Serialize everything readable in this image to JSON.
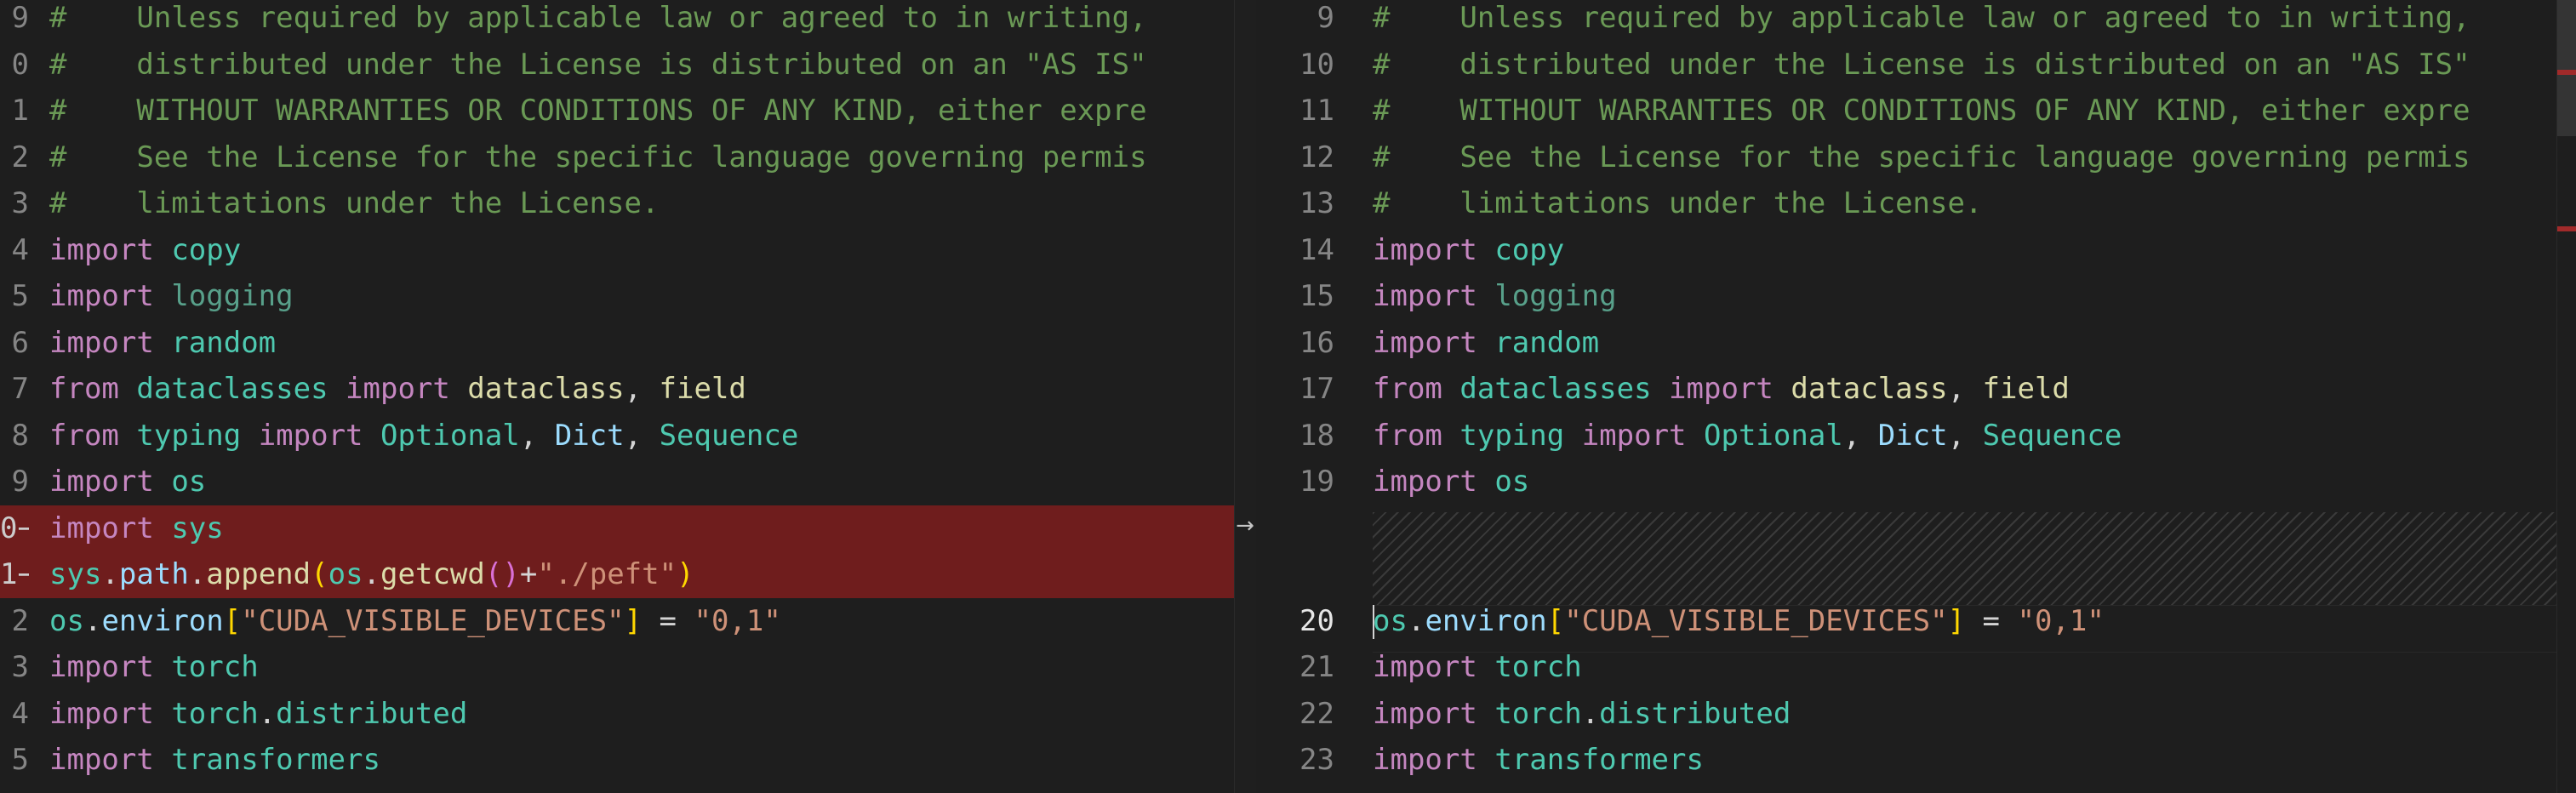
{
  "editor": {
    "mode": "diff",
    "revert_icon": "→",
    "colors": {
      "removed_bg": "#6f1d1d",
      "background": "#1e1e1e"
    }
  },
  "left": {
    "lines": [
      {
        "num": "9",
        "marker": "",
        "text": "#    Unless required by applicable law or agreed to in writing,"
      },
      {
        "num": "0",
        "marker": "",
        "text": "#    distributed under the License is distributed on an \"AS IS\""
      },
      {
        "num": "1",
        "marker": "",
        "text": "#    WITHOUT WARRANTIES OR CONDITIONS OF ANY KIND, either expre"
      },
      {
        "num": "2",
        "marker": "",
        "text": "#    See the License for the specific language governing permis"
      },
      {
        "num": "3",
        "marker": "",
        "text": "#    limitations under the License."
      },
      {
        "num": "4",
        "marker": "",
        "text": "import copy"
      },
      {
        "num": "5",
        "marker": "",
        "text": "import logging"
      },
      {
        "num": "6",
        "marker": "",
        "text": "import random"
      },
      {
        "num": "7",
        "marker": "",
        "text": "from dataclasses import dataclass, field"
      },
      {
        "num": "8",
        "marker": "",
        "text": "from typing import Optional, Dict, Sequence"
      },
      {
        "num": "9",
        "marker": "",
        "text": "import os"
      },
      {
        "num": "0",
        "marker": "−",
        "text": "import sys"
      },
      {
        "num": "1",
        "marker": "−",
        "text": "sys.path.append(os.getcwd()+\"./peft\")"
      },
      {
        "num": "2",
        "marker": "",
        "text": "os.environ[\"CUDA_VISIBLE_DEVICES\"] = \"0,1\""
      },
      {
        "num": "3",
        "marker": "",
        "text": "import torch"
      },
      {
        "num": "4",
        "marker": "",
        "text": "import torch.distributed"
      },
      {
        "num": "5",
        "marker": "",
        "text": "import transformers"
      }
    ]
  },
  "right": {
    "lines": [
      {
        "num": "9",
        "text": "#    Unless required by applicable law or agreed to in writing,"
      },
      {
        "num": "10",
        "text": "#    distributed under the License is distributed on an \"AS IS\""
      },
      {
        "num": "11",
        "text": "#    WITHOUT WARRANTIES OR CONDITIONS OF ANY KIND, either expre"
      },
      {
        "num": "12",
        "text": "#    See the License for the specific language governing permis"
      },
      {
        "num": "13",
        "text": "#    limitations under the License."
      },
      {
        "num": "14",
        "text": "import copy"
      },
      {
        "num": "15",
        "text": "import logging"
      },
      {
        "num": "16",
        "text": "import random"
      },
      {
        "num": "17",
        "text": "from dataclasses import dataclass, field"
      },
      {
        "num": "18",
        "text": "from typing import Optional, Dict, Sequence"
      },
      {
        "num": "19",
        "text": "import os"
      },
      {
        "num": "20",
        "text": "os.environ[\"CUDA_VISIBLE_DEVICES\"] = \"0,1\""
      },
      {
        "num": "21",
        "text": "import torch"
      },
      {
        "num": "22",
        "text": "import torch.distributed"
      },
      {
        "num": "23",
        "text": "import transformers"
      }
    ]
  }
}
